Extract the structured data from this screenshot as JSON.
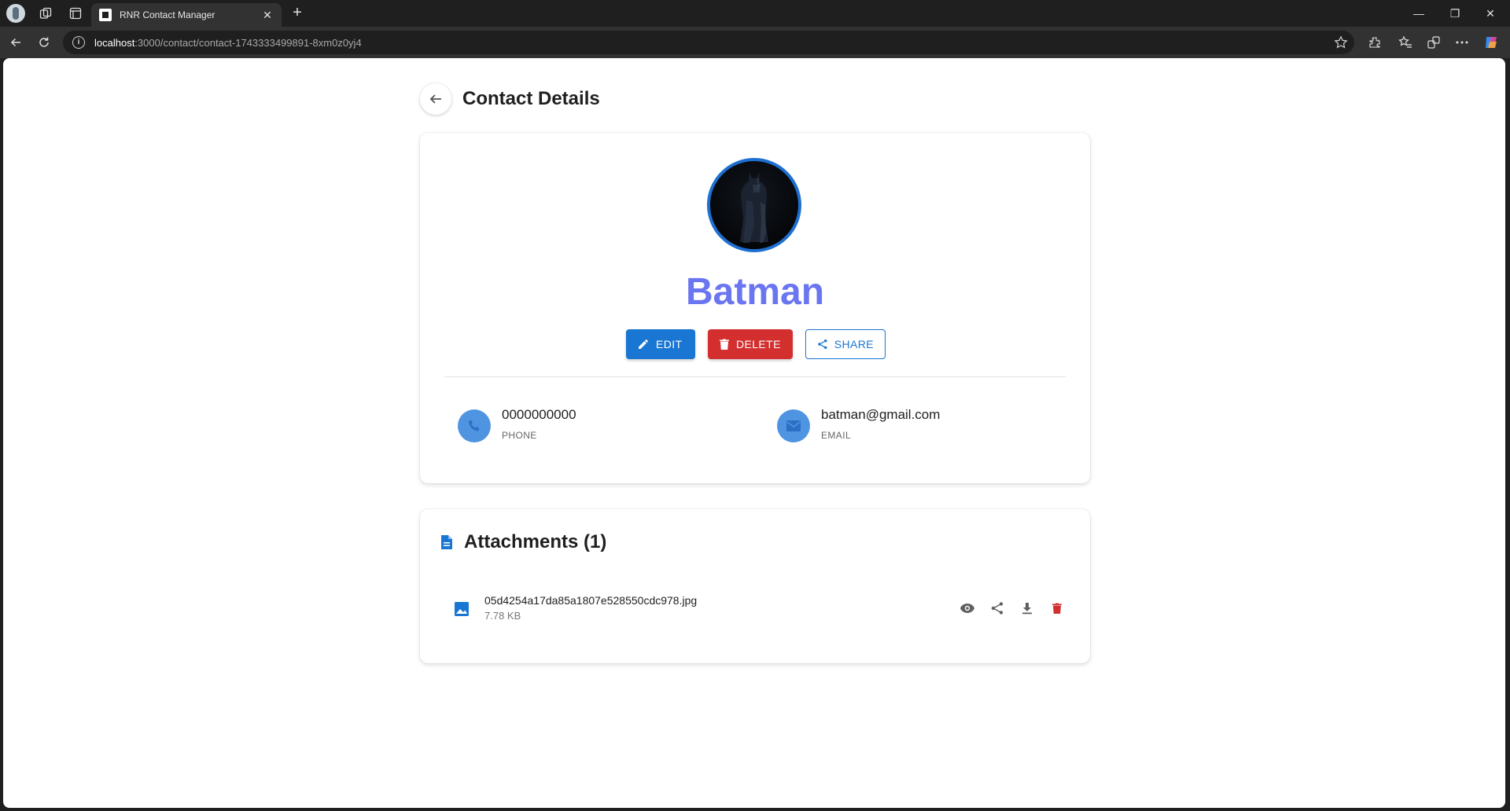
{
  "browser": {
    "tab_title": "RNR Contact Manager",
    "tab_close": "✕",
    "new_tab": "+",
    "url_host": "localhost",
    "url_rest": ":3000/contact/contact-1743333499891-8xm0z0yj4",
    "window_controls": {
      "minimize": "—",
      "restore": "❐",
      "close": "✕"
    },
    "info_glyph": "i"
  },
  "page": {
    "title": "Contact Details"
  },
  "contact": {
    "name": "Batman",
    "phone": "0000000000",
    "phone_label": "PHONE",
    "email": "batman@gmail.com",
    "email_label": "EMAIL"
  },
  "actions": {
    "edit": "EDIT",
    "delete": "DELETE",
    "share": "SHARE"
  },
  "attachments": {
    "title": "Attachments (1)",
    "items": [
      {
        "file_name": "05d4254a17da85a1807e528550cdc978.jpg",
        "file_size": "7.78 KB"
      }
    ]
  },
  "colors": {
    "primary": "#1976d2",
    "danger": "#d32f2f",
    "name_accent": "#6a75f0",
    "info_icon_bg": "#4f94e0"
  }
}
